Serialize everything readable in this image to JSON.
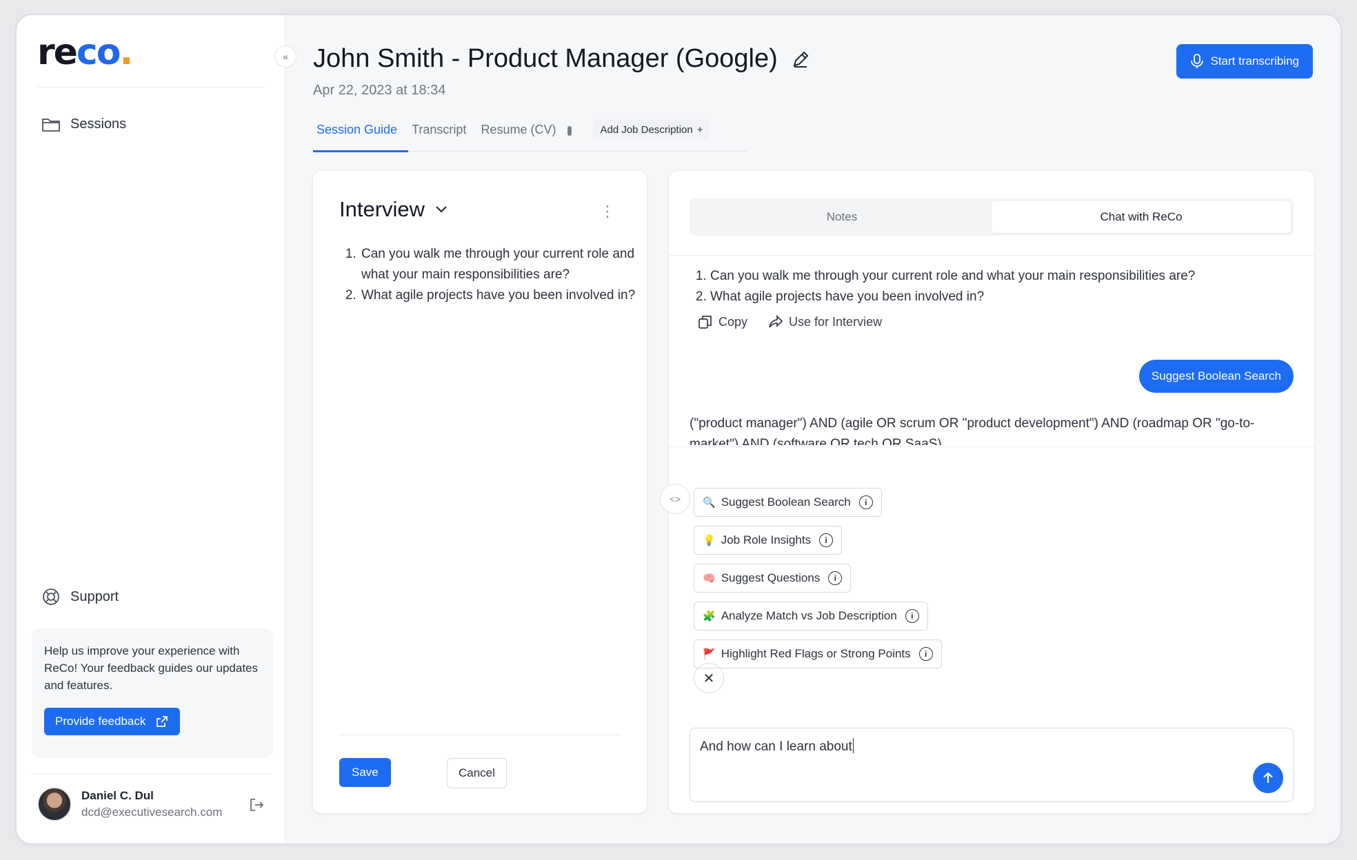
{
  "brand": {
    "logo_main": "re",
    "logo_accent": "co",
    "logo_dot": "."
  },
  "sidebar": {
    "sessions_label": "Sessions",
    "support_label": "Support",
    "feedback_text": "Help us improve your experience with ReCo! Your feedback guides our updates and features.",
    "feedback_button": "Provide feedback",
    "user_name": "Daniel C. Dul",
    "user_email": "dcd@executivesearch.com"
  },
  "header": {
    "title": "John Smith - Product Manager (Google)",
    "date": "Apr 22, 2023 at 18:34",
    "start_button": "Start transcribing"
  },
  "tabs": [
    {
      "label": "Session Guide",
      "active": true
    },
    {
      "label": "Transcript",
      "active": false
    },
    {
      "label": "Resume (CV)",
      "active": false
    }
  ],
  "add_tab": "Add Job Description",
  "interview": {
    "title": "Interview",
    "questions": [
      "Can you walk me through your current role and what your main responsibilities are?",
      "What agile projects have you been involved in?"
    ],
    "save": "Save",
    "cancel": "Cancel"
  },
  "chat": {
    "tabs": [
      "Notes",
      "Chat with ReCo"
    ],
    "active_tab": "Chat with ReCo",
    "answer": [
      "Can you walk me through your current role and what your main responsibilities are?",
      "What agile projects have you been involved in?"
    ],
    "copy": "Copy",
    "use_for_interview": "Use for Interview",
    "user_message": "Suggest Boolean Search",
    "boolean_result": "(\"product manager\") AND (agile OR scrum OR \"product development\") AND (roadmap OR \"go-to-market\") AND (software OR tech OR SaaS)",
    "suggestions": [
      {
        "emoji": "🔍",
        "label": "Suggest Boolean Search"
      },
      {
        "emoji": "💡",
        "label": "Job Role Insights"
      },
      {
        "emoji": "🧠",
        "label": "Suggest Questions"
      },
      {
        "emoji": "🧩",
        "label": "Analyze Match vs Job Description"
      },
      {
        "emoji": "🚩",
        "label": "Highlight Red Flags or Strong Points"
      }
    ],
    "input_value": "And how can I learn about"
  },
  "colors": {
    "primary": "#1d6cf2",
    "logo_dot": "#f39a1c"
  }
}
